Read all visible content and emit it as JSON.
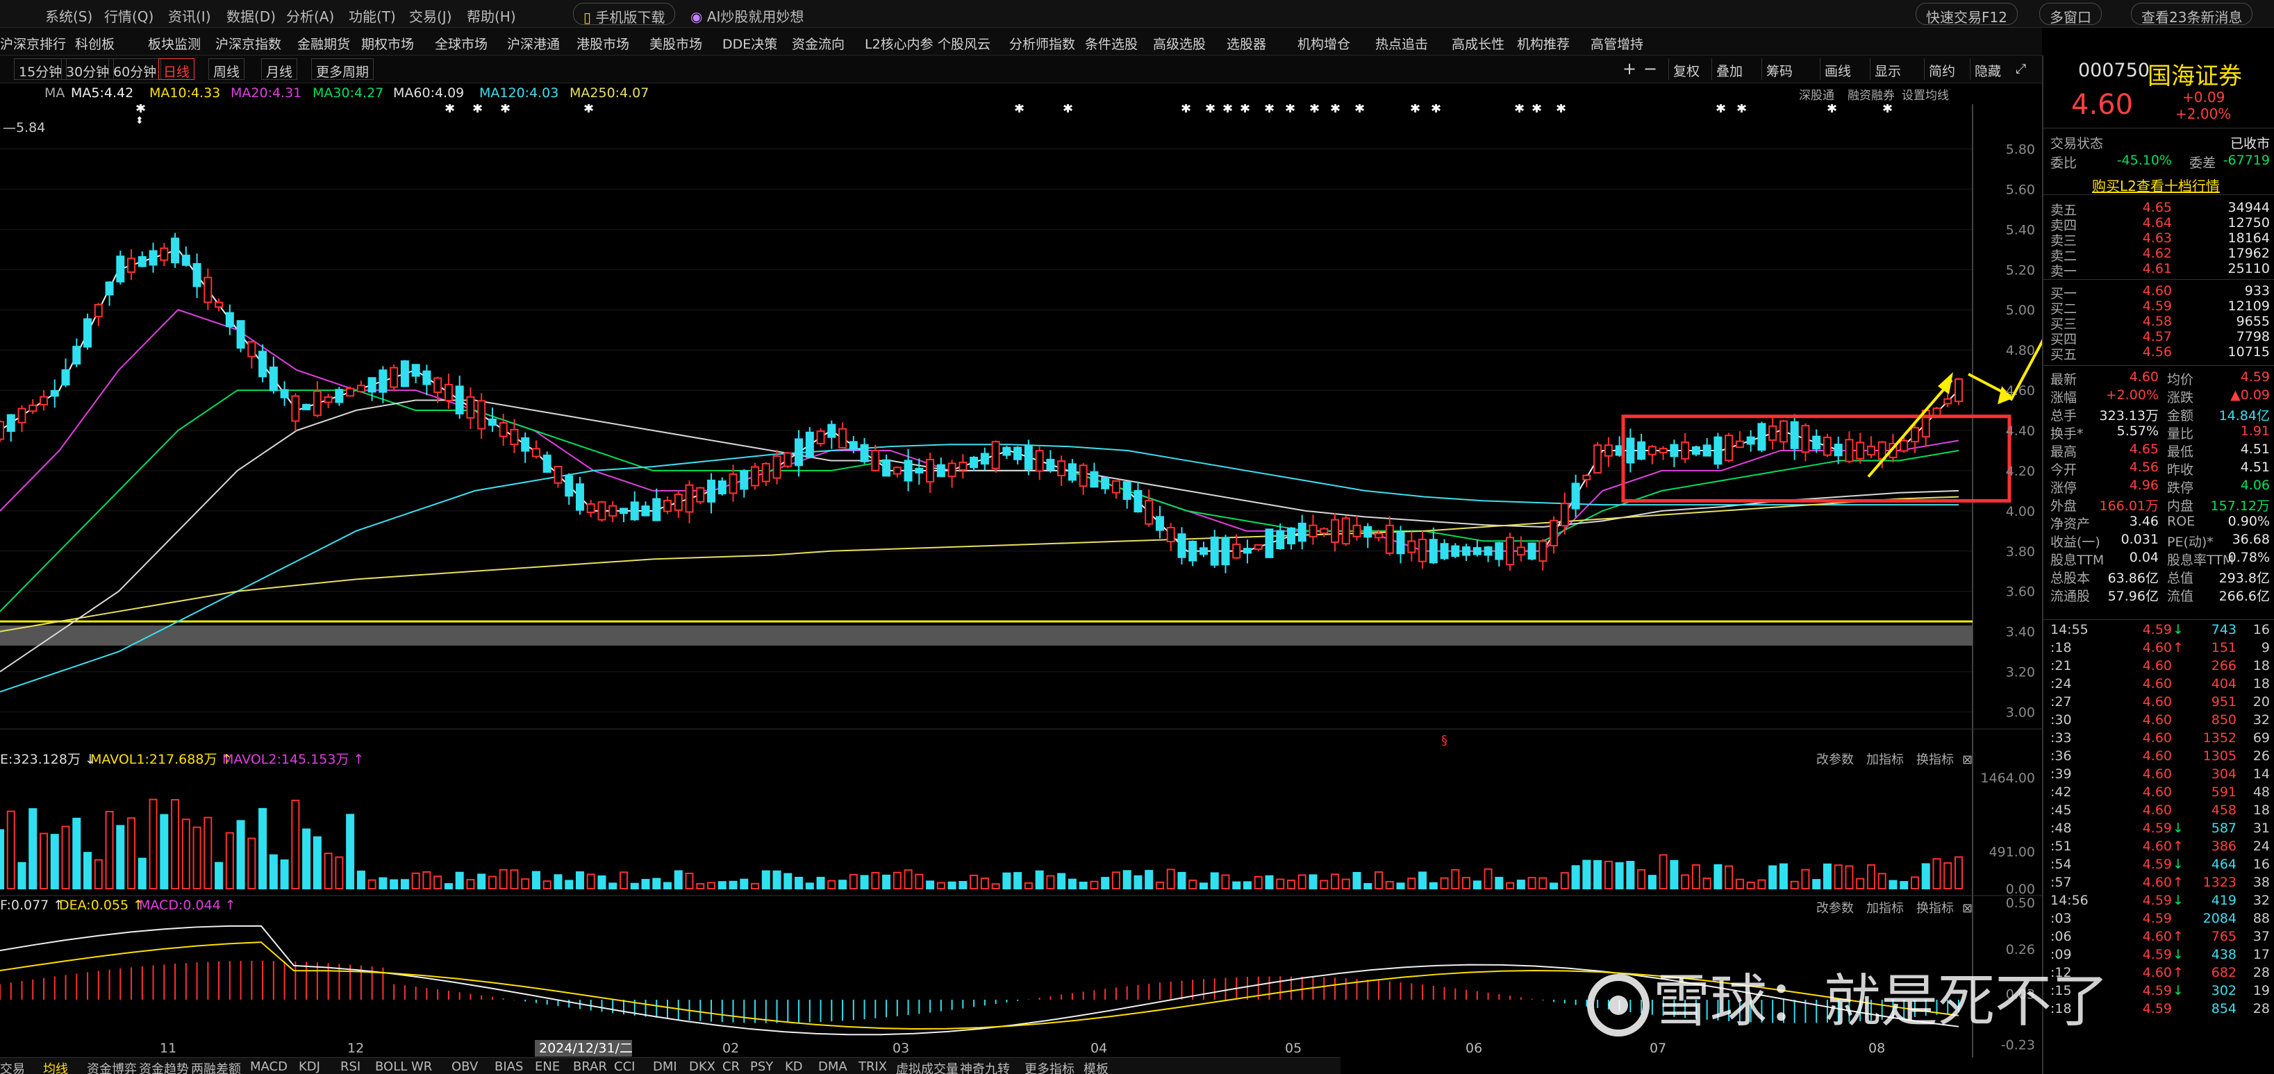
{
  "menu": {
    "items": [
      "系统(S)",
      "行情(Q)",
      "资讯(I)",
      "数据(D)",
      "分析(A)",
      "功能(T)",
      "交易(J)",
      "帮助(H)"
    ],
    "mobile_download": "手机版下载",
    "ai_promo": "AI炒股就用妙想",
    "quick_trade": "快速交易F12",
    "multi_window": "多窗口",
    "news_button": "查看23条新消息"
  },
  "nav": {
    "items": [
      "沪深京排行",
      "科创板",
      "板块监测",
      "沪深京指数",
      "金融期货",
      "期权市场",
      "全球市场",
      "沪深港通",
      "港股市场",
      "美股市场",
      "DDE决策",
      "资金流向",
      "L2核心内参",
      "个股风云",
      "分析师指数",
      "条件选股",
      "高级选股",
      "选股器",
      "机构增仓",
      "热点追击",
      "高成长性",
      "机构推荐",
      "高管增持"
    ]
  },
  "periods": [
    "15分钟",
    "30分钟",
    "60分钟",
    "日线",
    "周线",
    "月线",
    "更多周期"
  ],
  "active_period": "日线",
  "toolbar": [
    "复权",
    "叠加",
    "筹码",
    "画线",
    "显示",
    "简约",
    "隐藏"
  ],
  "ma_legend": {
    "label": "MA",
    "items": [
      {
        "text": "MA5:4.42",
        "color": "#f0f0f0"
      },
      {
        "text": "MA10:4.33",
        "color": "#ffe000"
      },
      {
        "text": "MA20:4.31",
        "color": "#e040e0"
      },
      {
        "text": "MA30:4.27",
        "color": "#00e05c"
      },
      {
        "text": "MA60:4.09",
        "color": "#e0e0e0"
      },
      {
        "text": "MA120:4.03",
        "color": "#3de0f0"
      },
      {
        "text": "MA250:4.07",
        "color": "#e8e060"
      }
    ]
  },
  "top_right_links": [
    "深股通",
    "融资融券",
    "设置均线"
  ],
  "price_axis": [
    "5.80",
    "5.60",
    "5.40",
    "5.20",
    "5.00",
    "4.80",
    "4.60",
    "4.40",
    "4.20",
    "4.00",
    "3.80",
    "3.60",
    "3.40",
    "3.20",
    "3.00"
  ],
  "left_price_label": "5.84",
  "vol_header": {
    "vol": "E:323.128万",
    "mavol1": "MAVOL1:217.688万",
    "mavol2": "MAVOL2:145.153万"
  },
  "vol_axis": [
    "1464.00",
    "491.00",
    "0.00"
  ],
  "macd_header": {
    "dif": "F:0.077",
    "dea": "DEA:0.055",
    "macd": "MACD:0.044"
  },
  "macd_axis": [
    "0.50",
    "0.26",
    "0.03",
    "-0.23"
  ],
  "panel_links": [
    "改参数",
    "加指标",
    "换指标"
  ],
  "x_axis": {
    "labels": [
      "11",
      "12",
      "02",
      "03",
      "04",
      "05",
      "06",
      "07",
      "08"
    ],
    "cursor_date": "2024/12/31/二"
  },
  "bottom_tabs": [
    "交易",
    "均线",
    "资金博弈",
    "资金趋势",
    "两融差额",
    "MACD",
    "KDJ",
    "RSI",
    "BOLL",
    "WR",
    "OBV",
    "BIAS",
    "ENE",
    "BRAR",
    "CCI",
    "DMI",
    "DKX",
    "CR",
    "PSY",
    "KD",
    "DMA",
    "TRIX",
    "虚拟成交量",
    "神奇九转",
    "更多指标",
    "模板"
  ],
  "quote": {
    "code": "000750",
    "name": "国海证券",
    "price": "4.60",
    "change": "+0.09",
    "change_pct": "+2.00%",
    "status_label": "交易状态",
    "status": "已收市",
    "weibi_label": "委比",
    "weibi": "-45.10%",
    "weicha_label": "委差",
    "weicha": "-67719",
    "l2_link": "购买L2查看十档行情",
    "asks": [
      {
        "label": "卖五",
        "price": "4.65",
        "vol": "34944"
      },
      {
        "label": "卖四",
        "price": "4.64",
        "vol": "12750"
      },
      {
        "label": "卖三",
        "price": "4.63",
        "vol": "18164"
      },
      {
        "label": "卖二",
        "price": "4.62",
        "vol": "17962"
      },
      {
        "label": "卖一",
        "price": "4.61",
        "vol": "25110"
      }
    ],
    "bids": [
      {
        "label": "买一",
        "price": "4.60",
        "vol": "933"
      },
      {
        "label": "买二",
        "price": "4.59",
        "vol": "12109"
      },
      {
        "label": "买三",
        "price": "4.58",
        "vol": "9655"
      },
      {
        "label": "买四",
        "price": "4.57",
        "vol": "7798"
      },
      {
        "label": "买五",
        "price": "4.56",
        "vol": "10715"
      }
    ],
    "stats": [
      {
        "l1": "最新",
        "v1": "4.60",
        "c1": "red",
        "l2": "均价",
        "v2": "4.59",
        "c2": "red"
      },
      {
        "l1": "涨幅",
        "v1": "+2.00%",
        "c1": "red",
        "l2": "涨跌",
        "v2": "▲0.09",
        "c2": "red"
      },
      {
        "l1": "总手",
        "v1": "323.13万",
        "c1": "wh",
        "l2": "金额",
        "v2": "14.84亿",
        "c2": "cy"
      },
      {
        "l1": "换手*",
        "v1": "5.57%",
        "c1": "wh",
        "l2": "量比",
        "v2": "1.91",
        "c2": "red"
      },
      {
        "l1": "最高",
        "v1": "4.65",
        "c1": "red",
        "l2": "最低",
        "v2": "4.51",
        "c2": "wh"
      },
      {
        "l1": "今开",
        "v1": "4.56",
        "c1": "red",
        "l2": "昨收",
        "v2": "4.51",
        "c2": "wh"
      },
      {
        "l1": "涨停",
        "v1": "4.96",
        "c1": "red",
        "l2": "跌停",
        "v2": "4.06",
        "c2": "green"
      },
      {
        "l1": "外盘",
        "v1": "166.01万",
        "c1": "red",
        "l2": "内盘",
        "v2": "157.12万",
        "c2": "green"
      },
      {
        "l1": "净资产",
        "v1": "3.46",
        "c1": "wh",
        "l2": "ROE",
        "v2": "0.90%",
        "c2": "wh"
      },
      {
        "l1": "收益(一)",
        "v1": "0.031",
        "c1": "wh",
        "l2": "PE(动)*",
        "v2": "36.68",
        "c2": "wh"
      },
      {
        "l1": "股息TTM",
        "v1": "0.04",
        "c1": "wh",
        "l2": "股息率TTM",
        "v2": "0.78%",
        "c2": "wh"
      },
      {
        "l1": "总股本",
        "v1": "63.86亿",
        "c1": "wh",
        "l2": "总值",
        "v2": "293.8亿",
        "c2": "wh"
      },
      {
        "l1": "流通股",
        "v1": "57.96亿",
        "c1": "wh",
        "l2": "流值",
        "v2": "266.6亿",
        "c2": "wh"
      }
    ]
  },
  "ticks": [
    {
      "t": "14:55",
      "p": "4.59",
      "a": "↓",
      "v": "743",
      "n": "16",
      "vc": "cy"
    },
    {
      "t": ":18",
      "p": "4.60",
      "a": "↑",
      "v": "151",
      "n": "9",
      "vc": "red"
    },
    {
      "t": ":21",
      "p": "4.60",
      "a": "",
      "v": "266",
      "n": "18",
      "vc": "red"
    },
    {
      "t": ":24",
      "p": "4.60",
      "a": "",
      "v": "404",
      "n": "18",
      "vc": "red"
    },
    {
      "t": ":27",
      "p": "4.60",
      "a": "",
      "v": "951",
      "n": "20",
      "vc": "red"
    },
    {
      "t": ":30",
      "p": "4.60",
      "a": "",
      "v": "850",
      "n": "32",
      "vc": "red"
    },
    {
      "t": ":33",
      "p": "4.60",
      "a": "",
      "v": "1352",
      "n": "69",
      "vc": "red"
    },
    {
      "t": ":36",
      "p": "4.60",
      "a": "",
      "v": "1305",
      "n": "26",
      "vc": "red"
    },
    {
      "t": ":39",
      "p": "4.60",
      "a": "",
      "v": "304",
      "n": "14",
      "vc": "red"
    },
    {
      "t": ":42",
      "p": "4.60",
      "a": "",
      "v": "591",
      "n": "48",
      "vc": "red"
    },
    {
      "t": ":45",
      "p": "4.60",
      "a": "",
      "v": "458",
      "n": "18",
      "vc": "red"
    },
    {
      "t": ":48",
      "p": "4.59",
      "a": "↓",
      "v": "587",
      "n": "31",
      "vc": "cy"
    },
    {
      "t": ":51",
      "p": "4.60",
      "a": "↑",
      "v": "386",
      "n": "24",
      "vc": "red"
    },
    {
      "t": ":54",
      "p": "4.59",
      "a": "↓",
      "v": "464",
      "n": "16",
      "vc": "cy"
    },
    {
      "t": ":57",
      "p": "4.60",
      "a": "↑",
      "v": "1323",
      "n": "38",
      "vc": "red"
    },
    {
      "t": "14:56",
      "p": "4.59",
      "a": "↓",
      "v": "419",
      "n": "32",
      "vc": "cy"
    },
    {
      "t": ":03",
      "p": "4.59",
      "a": "",
      "v": "2084",
      "n": "88",
      "vc": "cy"
    },
    {
      "t": ":06",
      "p": "4.60",
      "a": "↑",
      "v": "765",
      "n": "37",
      "vc": "red"
    },
    {
      "t": ":09",
      "p": "4.59",
      "a": "↓",
      "v": "438",
      "n": "17",
      "vc": "cy"
    },
    {
      "t": ":12",
      "p": "4.60",
      "a": "↑",
      "v": "682",
      "n": "28",
      "vc": "red"
    },
    {
      "t": ":15",
      "p": "4.59",
      "a": "↓",
      "v": "302",
      "n": "19",
      "vc": "cy"
    },
    {
      "t": ":18",
      "p": "4.59",
      "a": "",
      "v": "854",
      "n": "28",
      "vc": "cy"
    }
  ],
  "watermark": "雪球：就是死不了",
  "chart_data": {
    "type": "candlestick",
    "ylim": [
      2.95,
      5.85
    ],
    "colors": {
      "up": "#ff3030",
      "down": "#30e0f0",
      "box": "#ff3030",
      "arrow": "#ffee00",
      "support": "#f0f000"
    },
    "support_line": 3.45,
    "ma_curves": [
      {
        "name": "MA5",
        "color": "#f0f0f0",
        "values": [
          4.4,
          4.6,
          5.2,
          5.3,
          4.9,
          4.5,
          4.6,
          4.7,
          4.5,
          4.3,
          4.0,
          4.0,
          4.1,
          4.2,
          4.4,
          4.2,
          4.2,
          4.3,
          4.2,
          4.1,
          3.8,
          3.8,
          3.9,
          3.9,
          3.8,
          3.8,
          3.8,
          4.3,
          4.3,
          4.3,
          4.4,
          4.3,
          4.3,
          4.6
        ]
      },
      {
        "name": "MA20",
        "color": "#e040e0",
        "values": [
          4.0,
          4.3,
          4.7,
          5.0,
          4.9,
          4.7,
          4.6,
          4.6,
          4.5,
          4.4,
          4.2,
          4.1,
          4.1,
          4.2,
          4.3,
          4.3,
          4.2,
          4.2,
          4.2,
          4.1,
          4.0,
          3.9,
          3.9,
          3.9,
          3.8,
          3.8,
          3.8,
          4.1,
          4.2,
          4.2,
          4.3,
          4.3,
          4.3,
          4.35
        ]
      },
      {
        "name": "MA30",
        "color": "#00e05c",
        "values": [
          3.5,
          3.8,
          4.1,
          4.4,
          4.6,
          4.6,
          4.6,
          4.5,
          4.5,
          4.4,
          4.3,
          4.2,
          4.2,
          4.2,
          4.2,
          4.25,
          4.2,
          4.2,
          4.2,
          4.1,
          4.0,
          3.95,
          3.9,
          3.9,
          3.9,
          3.85,
          3.85,
          4.0,
          4.1,
          4.15,
          4.2,
          4.25,
          4.25,
          4.3
        ]
      },
      {
        "name": "MA60",
        "color": "#d8d8d8",
        "values": [
          3.2,
          3.4,
          3.6,
          3.9,
          4.2,
          4.4,
          4.5,
          4.55,
          4.55,
          4.5,
          4.45,
          4.4,
          4.35,
          4.3,
          4.25,
          4.25,
          4.2,
          4.2,
          4.2,
          4.15,
          4.1,
          4.05,
          4.0,
          3.97,
          3.95,
          3.93,
          3.92,
          3.95,
          4.0,
          4.02,
          4.05,
          4.07,
          4.09,
          4.1
        ]
      },
      {
        "name": "MA120",
        "color": "#3de0f0",
        "values": [
          3.1,
          3.2,
          3.3,
          3.45,
          3.6,
          3.75,
          3.9,
          4.0,
          4.1,
          4.15,
          4.2,
          4.22,
          4.25,
          4.28,
          4.3,
          4.32,
          4.33,
          4.33,
          4.32,
          4.3,
          4.25,
          4.2,
          4.15,
          4.1,
          4.07,
          4.05,
          4.04,
          4.03,
          4.03,
          4.03,
          4.03,
          4.03,
          4.03,
          4.03
        ]
      },
      {
        "name": "MA250",
        "color": "#e8e060",
        "values": [
          3.4,
          3.45,
          3.5,
          3.55,
          3.6,
          3.63,
          3.66,
          3.68,
          3.7,
          3.72,
          3.74,
          3.76,
          3.77,
          3.78,
          3.8,
          3.81,
          3.82,
          3.83,
          3.84,
          3.85,
          3.86,
          3.87,
          3.88,
          3.89,
          3.9,
          3.92,
          3.94,
          3.96,
          3.98,
          4.0,
          4.02,
          4.04,
          4.06,
          4.07
        ]
      }
    ],
    "volume_ylim": [
      0,
      1464
    ],
    "macd_ylim": [
      -0.25,
      0.5
    ]
  }
}
